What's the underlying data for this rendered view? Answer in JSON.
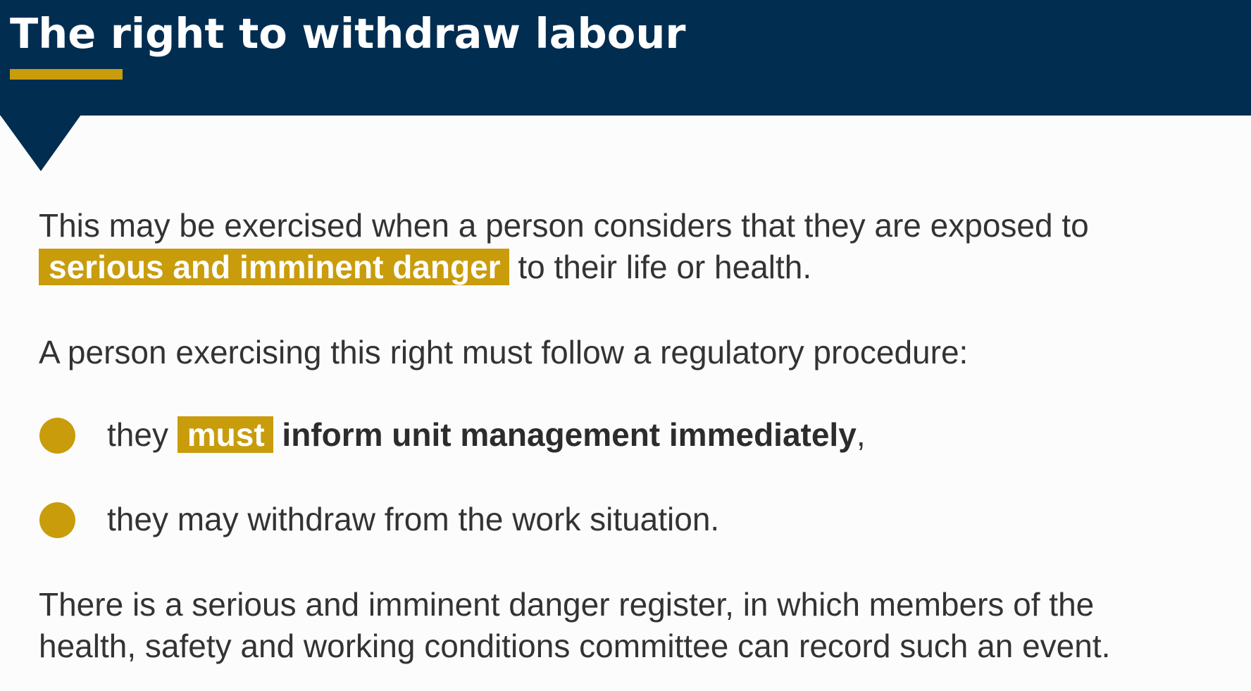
{
  "header": {
    "title": "The right to withdraw labour",
    "background_color": "#012d51",
    "accent_color": "#c99c0c"
  },
  "paragraph1": {
    "line1": "This may be exercised when a person considers that they are exposed to",
    "highlight": "serious and imminent danger",
    "line2_rest": " to their life or health."
  },
  "paragraph2": {
    "text": "A person exercising this right must follow a regulatory procedure:"
  },
  "bullets": [
    {
      "prefix": "they ",
      "highlight": "must",
      "bold": "inform unit management immediately",
      "suffix": ","
    },
    {
      "text": "they may withdraw from the work situation."
    }
  ],
  "paragraph3": {
    "line1": "There is a serious and imminent danger register, in which members of the",
    "line2": "health, safety and working conditions committee can record such an event."
  }
}
